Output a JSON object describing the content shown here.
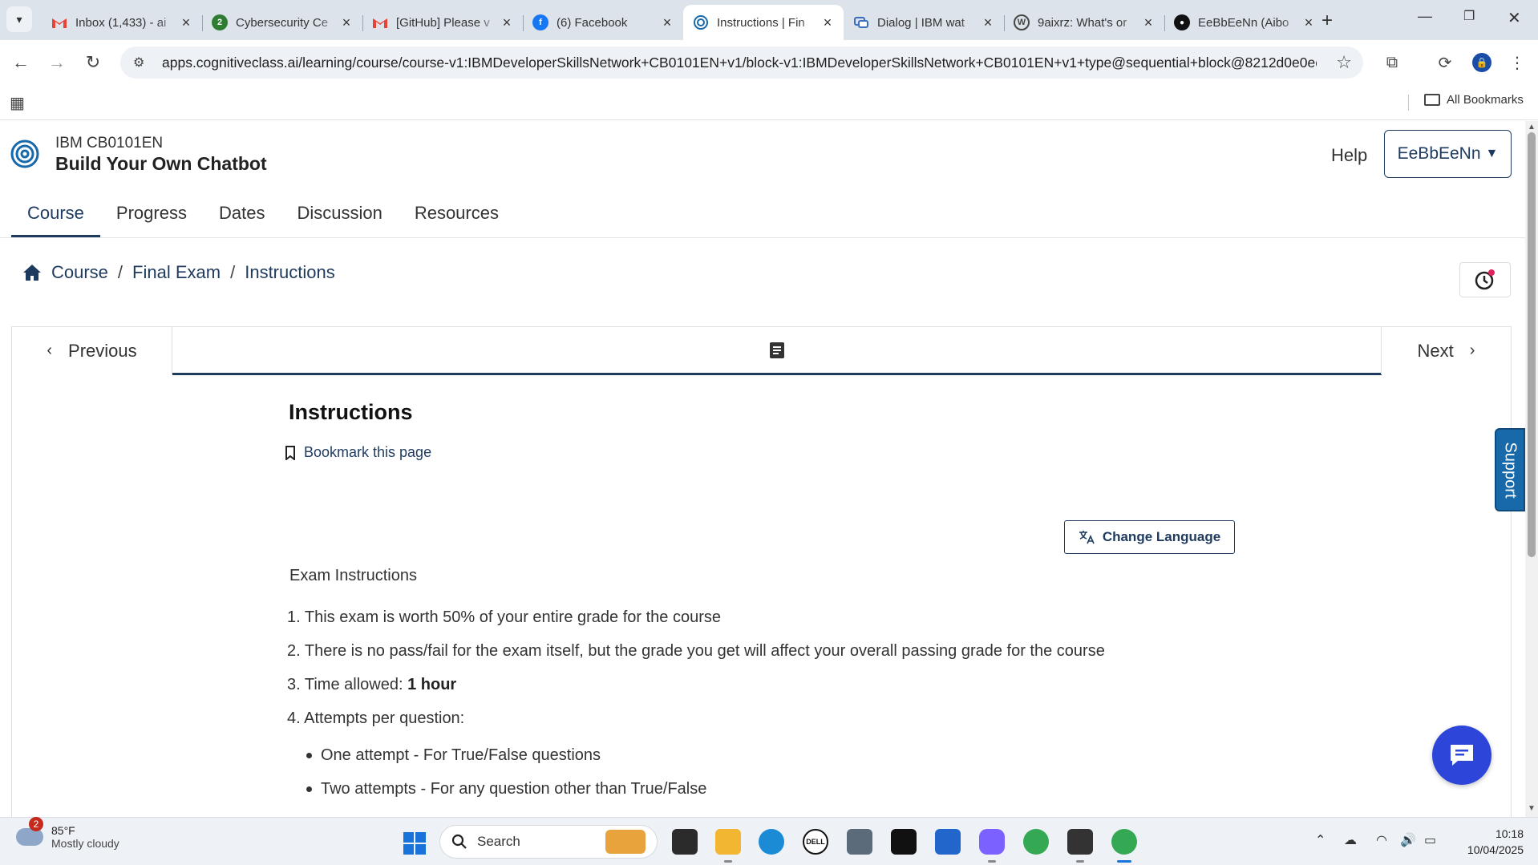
{
  "browser": {
    "tabs": [
      {
        "title": "Inbox (1,433) - ai",
        "icon": "gmail-icon",
        "active": false
      },
      {
        "title": "Cybersecurity Ce",
        "icon": "circle-2-icon",
        "active": false
      },
      {
        "title": "[GitHub] Please v",
        "icon": "gmail-icon",
        "active": false
      },
      {
        "title": "(6) Facebook",
        "icon": "facebook-icon",
        "active": false
      },
      {
        "title": "Instructions | Fin",
        "icon": "cognitiveclass-icon",
        "active": true
      },
      {
        "title": "Dialog | IBM wat",
        "icon": "ibm-watson-icon",
        "active": false
      },
      {
        "title": "9aixrz: What's or",
        "icon": "wordpress-icon",
        "active": false
      },
      {
        "title": "EeBbEeNn (Aibo",
        "icon": "github-icon",
        "active": false
      }
    ],
    "url": "apps.cognitiveclass.ai/learning/course/course-v1:IBMDeveloperSkillsNetwork+CB0101EN+v1/block-v1:IBMDeveloperSkillsNetwork+CB0101EN+v1+type@sequential+block@8212d0e0ec...",
    "bookmarks_all": "All Bookmarks"
  },
  "header": {
    "course_code": "IBM CB0101EN",
    "course_title": "Build Your Own Chatbot",
    "help": "Help",
    "user": "EeBbEeNn"
  },
  "course_tabs": [
    "Course",
    "Progress",
    "Dates",
    "Discussion",
    "Resources"
  ],
  "breadcrumb": [
    "Course",
    "Final Exam",
    "Instructions"
  ],
  "sequence": {
    "previous": "Previous",
    "next": "Next"
  },
  "unit": {
    "title": "Instructions",
    "bookmark": "Bookmark this page",
    "change_language": "Change Language",
    "exam_heading": "Exam Instructions",
    "items": [
      {
        "pre": "1. This exam is worth 50% of your entire grade for the course",
        "bold": ""
      },
      {
        "pre": "2. There is no pass/fail for the exam itself, but the grade you get will affect your overall passing grade for the course",
        "bold": ""
      },
      {
        "pre": "3. Time allowed: ",
        "bold": "1 hour"
      },
      {
        "pre": "4. Attempts per question:",
        "bold": ""
      }
    ],
    "sub_items": [
      "One attempt - For True/False questions",
      "Two attempts - For any question other than True/False"
    ]
  },
  "support": "Support",
  "taskbar": {
    "weather_badge": "2",
    "temp": "85°F",
    "weather": "Mostly cloudy",
    "search": "Search",
    "time": "10:18",
    "date": "10/04/2025"
  },
  "colors": {
    "brand": "#1e3a5f",
    "support": "#1769aa",
    "chat": "#2d46d9"
  }
}
